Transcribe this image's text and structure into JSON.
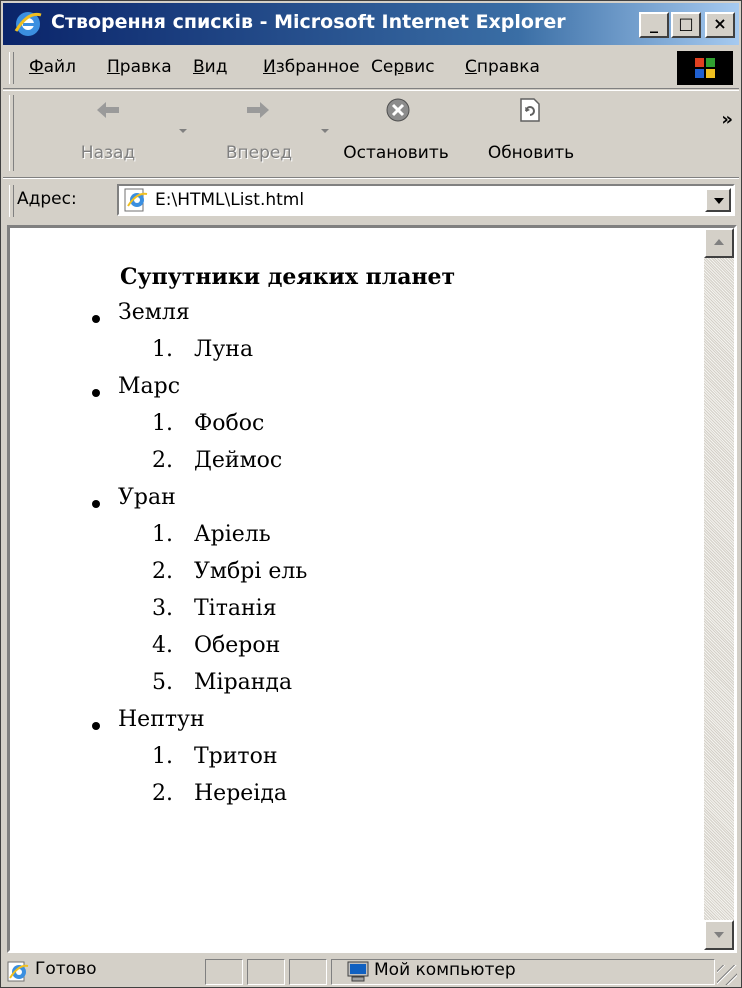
{
  "window": {
    "title": "Створення списків - Microsoft Internet Explorer",
    "buttons": {
      "minimize": "_",
      "maximize": "□",
      "close": "×"
    }
  },
  "menubar": {
    "items": [
      {
        "label": "Файл",
        "accesskey": "Ф"
      },
      {
        "label": "Правка",
        "accesskey": "П"
      },
      {
        "label": "Вид",
        "accesskey": "В"
      },
      {
        "label": "Избранное",
        "accesskey": "И"
      },
      {
        "label": "Сервис",
        "accesskey": "р"
      },
      {
        "label": "Справка",
        "accesskey": "С"
      }
    ]
  },
  "toolbar": {
    "back_label": "Назад",
    "forward_label": "Вперед",
    "stop_label": "Остановить",
    "refresh_label": "Обновить",
    "more": "»"
  },
  "address": {
    "label": "Адрес:",
    "url": "E:\\HTML\\List.html"
  },
  "page": {
    "heading": "Супутники деяких планет",
    "planets": [
      {
        "name": "Земля",
        "moons": [
          "Луна"
        ]
      },
      {
        "name": "Марс",
        "moons": [
          "Фобос",
          "Деймос"
        ]
      },
      {
        "name": "Уран",
        "moons": [
          "Аріель",
          "Умбрі ель",
          "Тітанія",
          "Оберон",
          "Міранда"
        ]
      },
      {
        "name": "Нептун",
        "moons": [
          "Тритон",
          "Нереіда"
        ]
      }
    ]
  },
  "statusbar": {
    "status": "Готово",
    "zone": "Мой компьютер"
  }
}
